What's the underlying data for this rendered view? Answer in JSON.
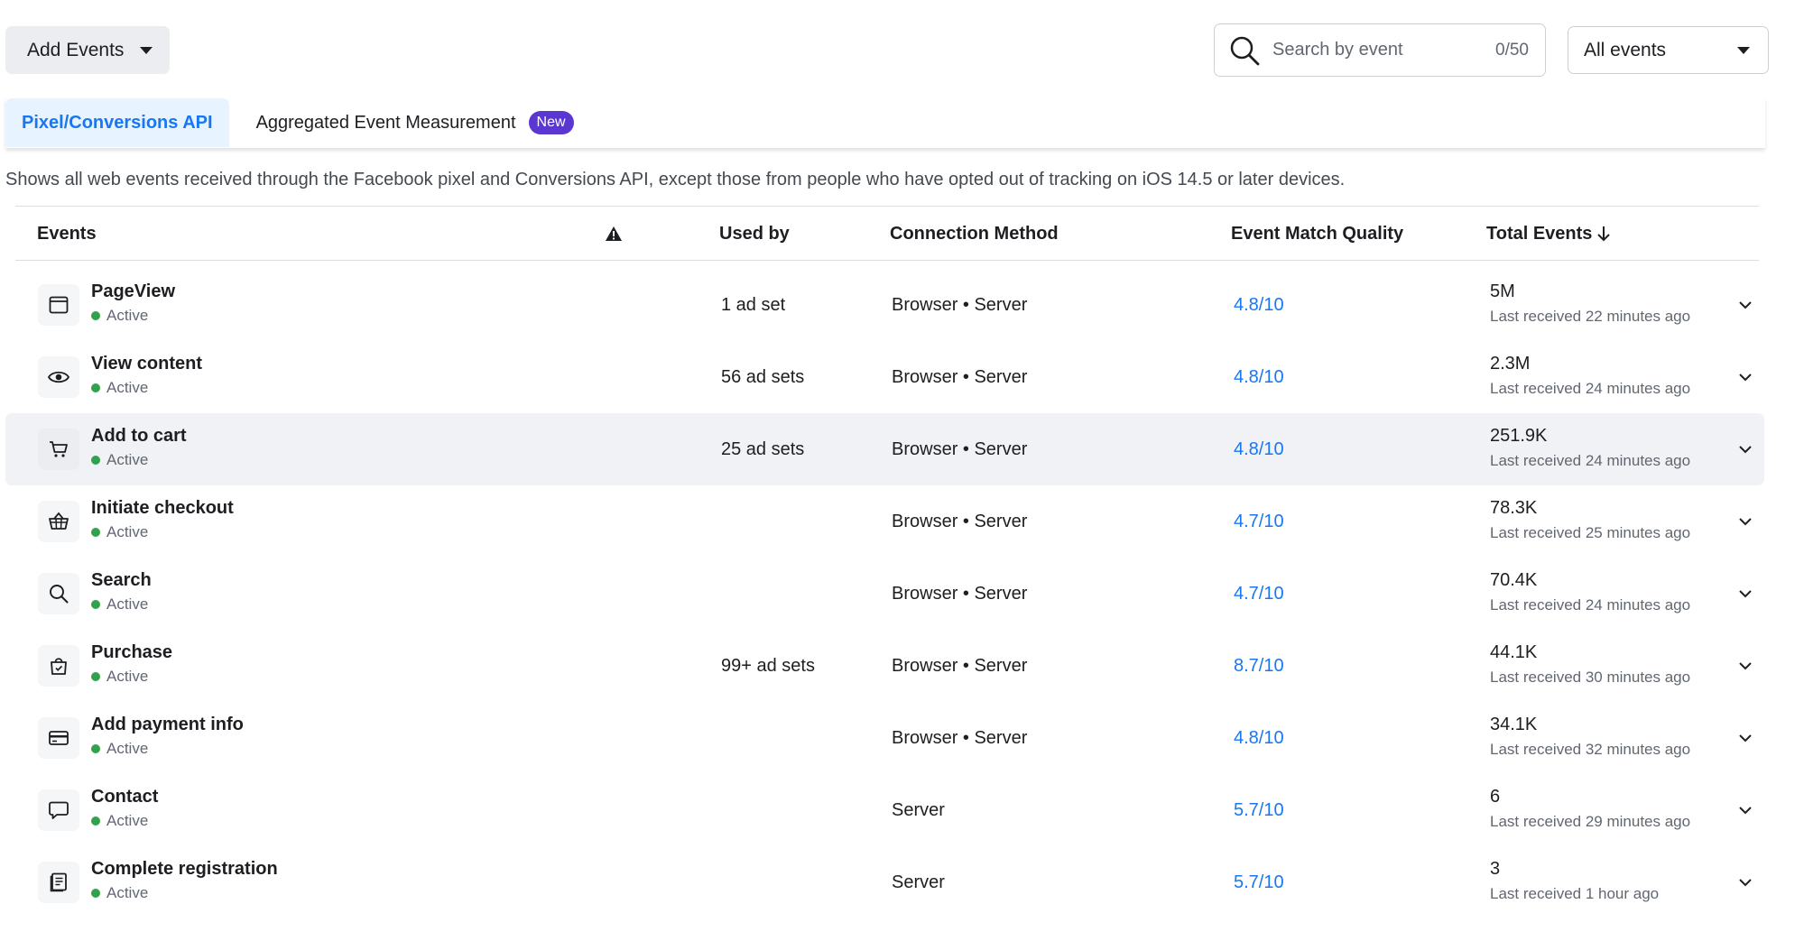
{
  "toolbar": {
    "add_events_label": "Add Events",
    "search_placeholder": "Search by event",
    "search_counter": "0/50",
    "filter_value": "All events"
  },
  "tabs": [
    {
      "label": "Pixel/Conversions API",
      "active": true
    },
    {
      "label": "Aggregated Event Measurement",
      "active": false,
      "badge": "New"
    }
  ],
  "description": "Shows all web events received through the Facebook pixel and Conversions API, except those from people who have opted out of tracking on iOS 14.5 or later devices.",
  "table": {
    "headers": {
      "events": "Events",
      "used_by": "Used by",
      "connection_method": "Connection Method",
      "event_match_quality": "Event Match Quality",
      "total_events": "Total Events"
    },
    "rows": [
      {
        "name": "PageView",
        "icon": "browser-window-icon",
        "status": "Active",
        "used_by": "1 ad set",
        "connection": "Browser • Server",
        "emq": "4.8/10",
        "total": "5M",
        "last_received": "Last received 22 minutes ago"
      },
      {
        "name": "View content",
        "icon": "eye-icon",
        "status": "Active",
        "used_by": "56 ad sets",
        "connection": "Browser • Server",
        "emq": "4.8/10",
        "total": "2.3M",
        "last_received": "Last received 24 minutes ago"
      },
      {
        "name": "Add to cart",
        "icon": "cart-icon",
        "status": "Active",
        "used_by": "25 ad sets",
        "connection": "Browser • Server",
        "emq": "4.8/10",
        "total": "251.9K",
        "last_received": "Last received 24 minutes ago",
        "highlighted": true
      },
      {
        "name": "Initiate checkout",
        "icon": "basket-icon",
        "status": "Active",
        "used_by": "",
        "connection": "Browser • Server",
        "emq": "4.7/10",
        "total": "78.3K",
        "last_received": "Last received 25 minutes ago"
      },
      {
        "name": "Search",
        "icon": "search-icon",
        "status": "Active",
        "used_by": "",
        "connection": "Browser • Server",
        "emq": "4.7/10",
        "total": "70.4K",
        "last_received": "Last received 24 minutes ago"
      },
      {
        "name": "Purchase",
        "icon": "shopping-bag-icon",
        "status": "Active",
        "used_by": "99+ ad sets",
        "connection": "Browser • Server",
        "emq": "8.7/10",
        "total": "44.1K",
        "last_received": "Last received 30 minutes ago"
      },
      {
        "name": "Add payment info",
        "icon": "credit-card-icon",
        "status": "Active",
        "used_by": "",
        "connection": "Browser • Server",
        "emq": "4.8/10",
        "total": "34.1K",
        "last_received": "Last received 32 minutes ago"
      },
      {
        "name": "Contact",
        "icon": "chat-bubble-icon",
        "status": "Active",
        "used_by": "",
        "connection": "Server",
        "emq": "5.7/10",
        "total": "6",
        "last_received": "Last received 29 minutes ago"
      },
      {
        "name": "Complete registration",
        "icon": "registration-form-icon",
        "status": "Active",
        "used_by": "",
        "connection": "Server",
        "emq": "5.7/10",
        "total": "3",
        "last_received": "Last received 1 hour ago"
      }
    ]
  },
  "colors": {
    "accent": "#1877f2",
    "active_tab_bg": "#e7f3ff",
    "badge_new": "#5b37d1",
    "status_active": "#31a24c",
    "row_highlight": "#f0f2f5"
  }
}
